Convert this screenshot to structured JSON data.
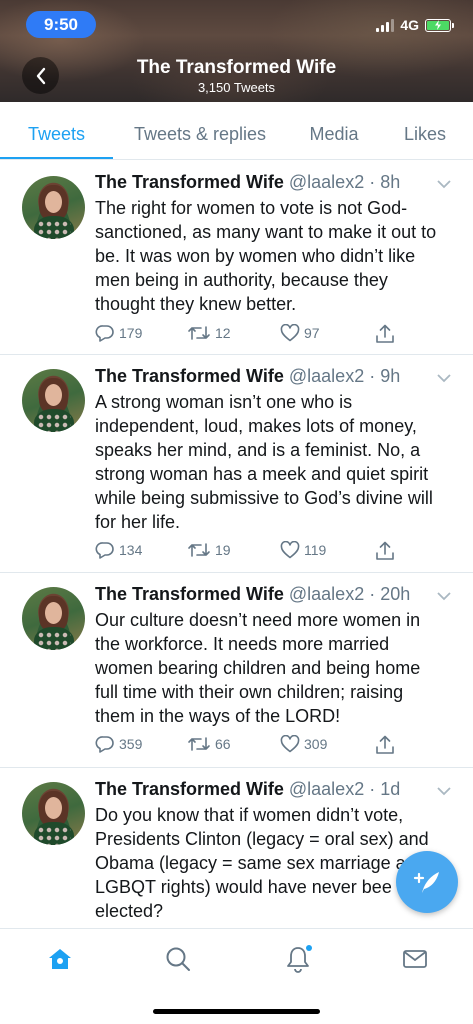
{
  "status": {
    "time": "9:50",
    "network": "4G"
  },
  "header": {
    "title": "The Transformed Wife",
    "subtitle": "3,150 Tweets"
  },
  "tabs": [
    {
      "label": "Tweets",
      "active": true
    },
    {
      "label": "Tweets & replies",
      "active": false
    },
    {
      "label": "Media",
      "active": false
    },
    {
      "label": "Likes",
      "active": false
    }
  ],
  "tweets": [
    {
      "name": "The Transformed Wife",
      "handle": "@laalex2",
      "time": "8h",
      "meta": "@laalex2 · 8h",
      "text": "The right for women to vote is not God-\nsanctioned, as many want to make it out to\nbe. It was won by women who didn’t like\nmen being in authority, because they\nthought they knew better.",
      "replies": "179",
      "retweets": "12",
      "likes": "97"
    },
    {
      "name": "The Transformed Wife",
      "handle": "@laalex2",
      "time": "9h",
      "meta": "@laalex2 · 9h",
      "text": "A strong woman isn’t one who is\nindependent, loud, makes lots of money,\nspeaks her mind, and is a feminist. No, a\nstrong woman has a meek and quiet spirit\nwhile being submissive to God’s divine will\nfor her life.",
      "replies": "134",
      "retweets": "19",
      "likes": "119"
    },
    {
      "name": "The Transformed Wife",
      "handle": "@laalex2",
      "time": "20h",
      "meta": "@laalex2 · 20h",
      "text": "Our culture doesn’t need more women in\nthe workforce. It needs more married\nwomen bearing children and being home\nfull time with their own children; raising\nthem in the ways of the LORD!",
      "replies": "359",
      "retweets": "66",
      "likes": "309"
    },
    {
      "name": "The Transformed Wife",
      "handle": "@laalex2",
      "time": "1d",
      "meta": "@laalex2 · 1d",
      "text": "Do you know that if women didn’t vote,\nPresidents Clinton (legacy = oral sex) and\nObama (legacy = same sex marriage a\nLGBQT rights) would have never bee\nelected?"
    }
  ],
  "colors": {
    "accent": "#1da1f2",
    "text": "#14171a",
    "muted": "#657786",
    "divider": "#e1e8ed",
    "fab": "#4aa8f0"
  },
  "icons": {
    "back": "chevron-left-icon",
    "reply": "reply-icon",
    "retweet": "retweet-icon",
    "like": "heart-icon",
    "share": "share-icon",
    "compose": "compose-tweet-icon",
    "home": "home-icon",
    "search": "search-icon",
    "notifications": "bell-icon",
    "messages": "mail-icon"
  }
}
